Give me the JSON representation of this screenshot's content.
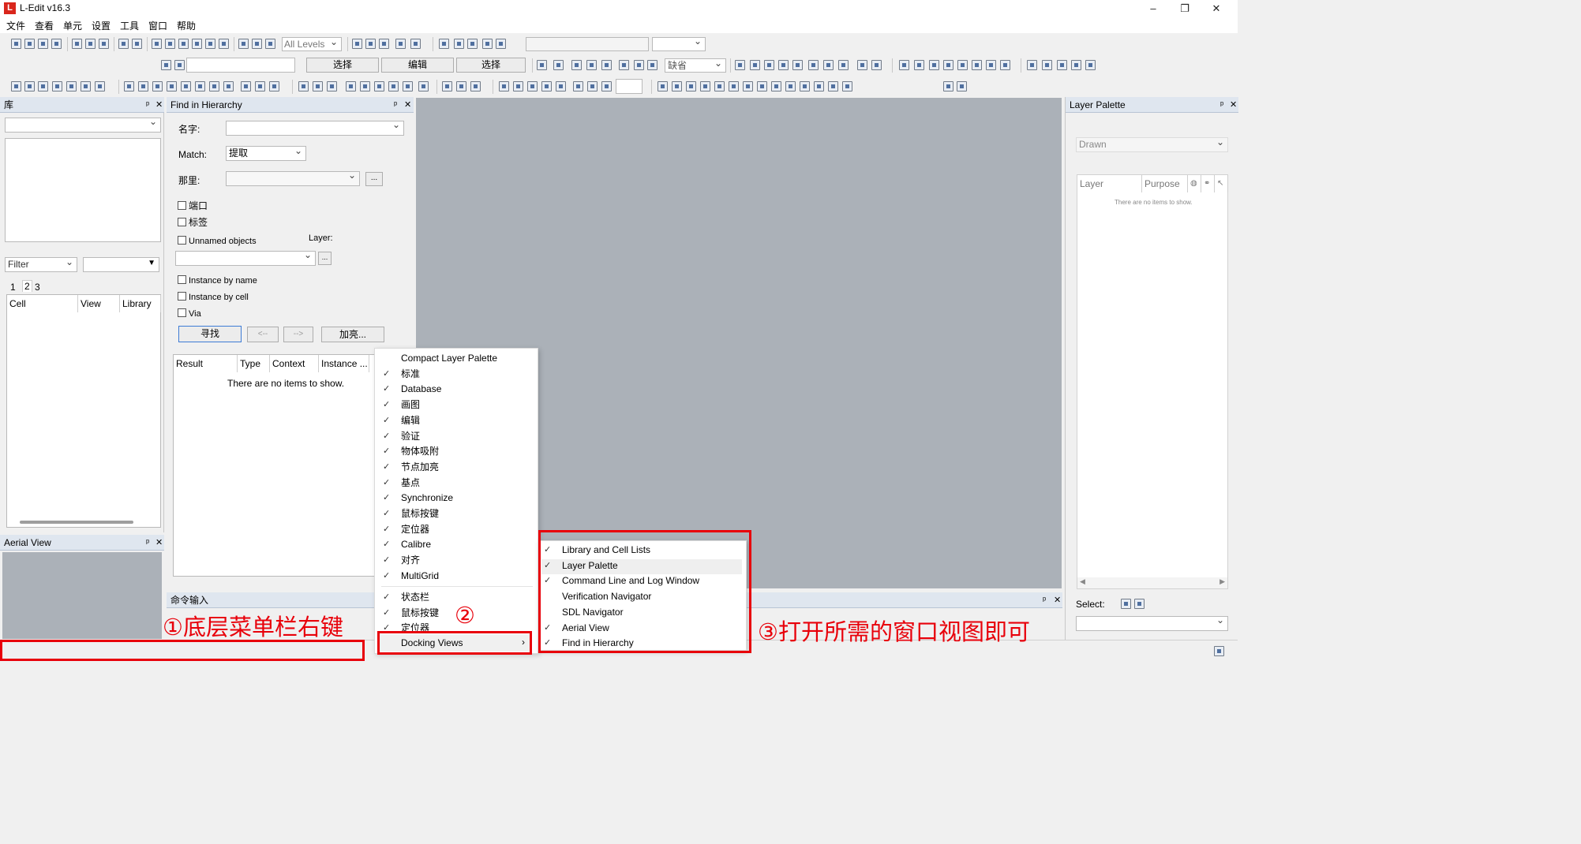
{
  "app": {
    "title": "L-Edit v16.3",
    "icon_letter": "L"
  },
  "window_controls": {
    "minimize": "–",
    "maximize": "❐",
    "close": "✕"
  },
  "menu": [
    "文件",
    "查看",
    "单元",
    "设置",
    "工具",
    "窗口",
    "帮助"
  ],
  "toolbar": {
    "levels_select": "All Levels",
    "mode_buttons": [
      "选择",
      "编辑",
      "选择"
    ],
    "default_select": "缺省"
  },
  "library_panel": {
    "title": "库",
    "filter_label": "Filter",
    "tabs": [
      "1",
      "2",
      "3"
    ],
    "columns": [
      "Cell",
      "View",
      "Library"
    ]
  },
  "find_panel": {
    "title": "Find in Hierarchy",
    "name_label": "名字:",
    "match_label": "Match:",
    "match_value": "提取",
    "where_label": "那里:",
    "ellipsis": "...",
    "checkboxes": [
      "端口",
      "标签",
      "Unnamed objects"
    ],
    "layer_label": "Layer:",
    "instance_checks": [
      "Instance by name",
      "Instance by cell",
      "Via"
    ],
    "buttons": {
      "find": "寻找",
      "prev": "<--",
      "next": "-->",
      "highlight": "加亮..."
    },
    "result_columns": [
      "Result",
      "Type",
      "Context",
      "Instance ..."
    ],
    "empty_text": "There are no items to show."
  },
  "aerial_panel": {
    "title": "Aerial View"
  },
  "command_panel": {
    "title": "命令输入"
  },
  "layer_palette": {
    "title": "Layer Palette",
    "drawn_value": "Drawn",
    "columns": [
      "Layer",
      "Purpose"
    ],
    "empty_text": "There are no items to show.",
    "select_label": "Select:"
  },
  "context_menu": {
    "items": [
      {
        "label": "Compact Layer Palette",
        "checked": false
      },
      {
        "label": "标准",
        "checked": true
      },
      {
        "label": "Database",
        "checked": true
      },
      {
        "label": "画图",
        "checked": true
      },
      {
        "label": "编辑",
        "checked": true
      },
      {
        "label": "验证",
        "checked": true
      },
      {
        "label": "物体吸附",
        "checked": true
      },
      {
        "label": "节点加亮",
        "checked": true
      },
      {
        "label": "基点",
        "checked": true
      },
      {
        "label": "Synchronize",
        "checked": true
      },
      {
        "label": "鼠标按键",
        "checked": true
      },
      {
        "label": "定位器",
        "checked": true
      },
      {
        "label": "Calibre",
        "checked": true
      },
      {
        "label": "对齐",
        "checked": true
      },
      {
        "label": "MultiGrid",
        "checked": true
      }
    ],
    "lower_items": [
      {
        "label": "状态栏",
        "checked": true
      },
      {
        "label": "鼠标按键",
        "checked": true
      },
      {
        "label": "定位器",
        "checked": true
      }
    ],
    "docking_label": "Docking Views",
    "arrow": "›"
  },
  "submenu": {
    "items": [
      {
        "label": "Library and Cell Lists",
        "checked": true
      },
      {
        "label": "Layer Palette",
        "checked": true
      },
      {
        "label": "Command Line and Log Window",
        "checked": true
      },
      {
        "label": "Verification Navigator",
        "checked": false
      },
      {
        "label": "SDL Navigator",
        "checked": false
      },
      {
        "label": "Aerial View",
        "checked": true
      },
      {
        "label": "Find in Hierarchy",
        "checked": true
      }
    ]
  },
  "annotations": {
    "step1": "①底层菜单栏右键",
    "step2": "②",
    "step3": "③打开所需的窗口视图即可"
  },
  "colors": {
    "annotation_red": "#e8000a",
    "canvas_gray": "#abb1b8",
    "panel_title_bg": "#dfe6ef"
  }
}
